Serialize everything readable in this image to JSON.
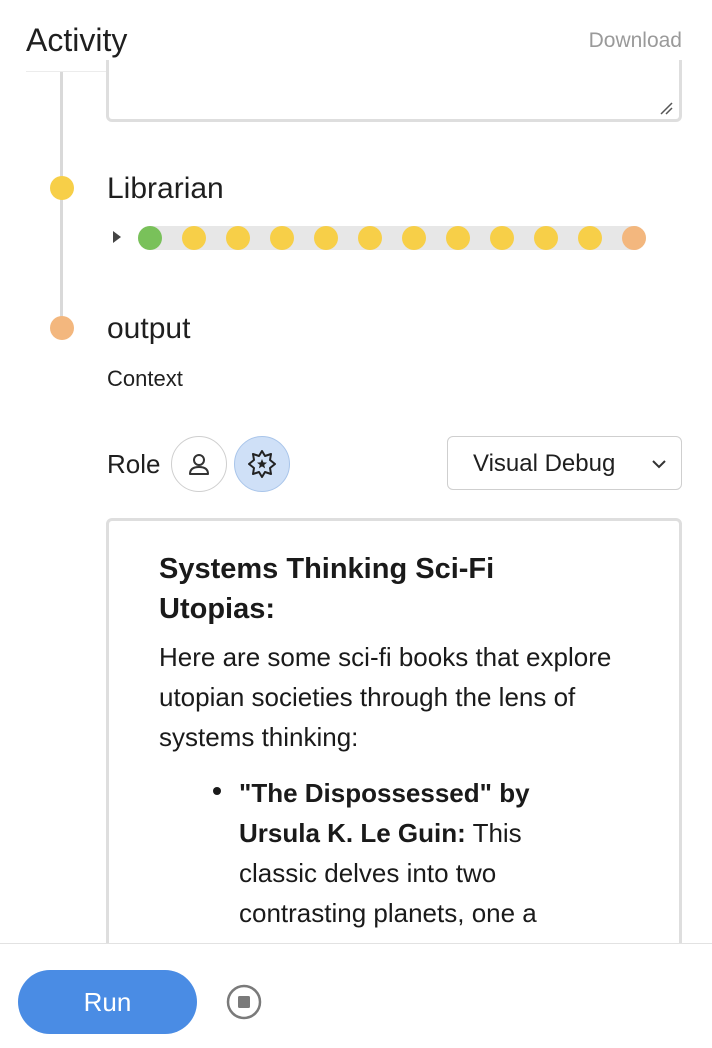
{
  "header": {
    "title": "Activity",
    "download_label": "Download"
  },
  "nodes": [
    {
      "title": "Librarian",
      "status_color": "#f7cf48",
      "steps": [
        "#79c15a",
        "#f7cf48",
        "#f7cf48",
        "#f7cf48",
        "#f7cf48",
        "#f7cf48",
        "#f7cf48",
        "#f7cf48",
        "#f7cf48",
        "#f7cf48",
        "#f7cf48",
        "#f3b77e"
      ]
    },
    {
      "title": "output",
      "status_color": "#f3b77e"
    }
  ],
  "output": {
    "context_label": "Context",
    "role_label": "Role",
    "role_options": [
      "user-icon",
      "agent-star-icon"
    ],
    "selected_role": "agent-star-icon",
    "view_mode": "Visual Debug",
    "content": {
      "heading": "Systems Thinking Sci-Fi Utopias:",
      "intro": "Here are some sci-fi books that explore utopian societies through the lens of systems thinking:",
      "items": [
        {
          "title": "\"The Dispossessed\" by Ursula K. Le Guin:",
          "text": " This classic delves into two contrasting planets, one a rigid capitalist society and the"
        }
      ]
    }
  },
  "footer": {
    "run_label": "Run",
    "stop_icon": "stop-icon"
  },
  "colors": {
    "accent": "#4a8ce4",
    "running": "#f7cf48",
    "success": "#79c15a",
    "pending": "#f3b77e"
  }
}
